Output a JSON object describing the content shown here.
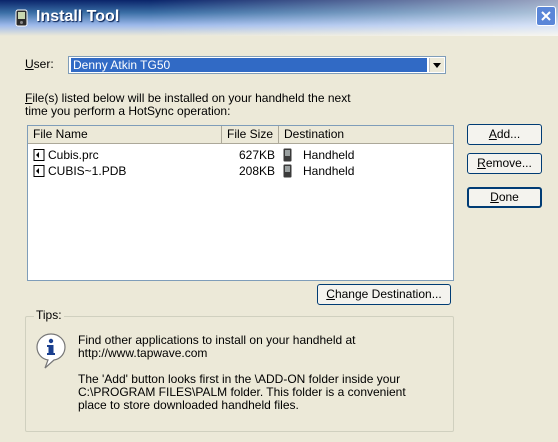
{
  "window": {
    "title": "Install Tool"
  },
  "user": {
    "label_first": "U",
    "label_rest": "ser:",
    "selected": "Denny Atkin TG50"
  },
  "intro": {
    "line1_first": "F",
    "line1_rest": "ile(s) listed below will be installed on your handheld the next",
    "line2": "time you perform a HotSync operation:"
  },
  "file_list": {
    "columns": [
      "File Name",
      "File Size",
      "Destination"
    ],
    "rows": [
      {
        "name": "Cubis.prc",
        "size": "627KB",
        "destination": "Handheld"
      },
      {
        "name": "CUBIS~1.PDB",
        "size": "208KB",
        "destination": "Handheld"
      }
    ]
  },
  "buttons": {
    "add_first": "A",
    "add_rest": "dd...",
    "remove_first": "R",
    "remove_rest": "emove...",
    "done_first": "D",
    "done_rest": "one",
    "change_first": "C",
    "change_rest": "hange Destination..."
  },
  "tips": {
    "title": "Tips:",
    "line1": "Find other applications to install on your handheld at",
    "line2": "http://www.tapwave.com",
    "line3": "The 'Add' button looks first in the \\ADD-ON folder inside your",
    "line4": "C:\\PROGRAM FILES\\PALM folder. This folder is a convenient",
    "line5": "place to store downloaded handheld files."
  },
  "icons": {
    "app": "palm-install-icon",
    "close": "close-icon",
    "dropdown": "chevron-down-icon",
    "file": "palm-file-icon",
    "handheld": "handheld-icon",
    "info": "info-icon"
  },
  "colors": {
    "title_bar": "#0a246a",
    "selection": "#316ac5",
    "dialog_bg": "#ece9d8"
  }
}
